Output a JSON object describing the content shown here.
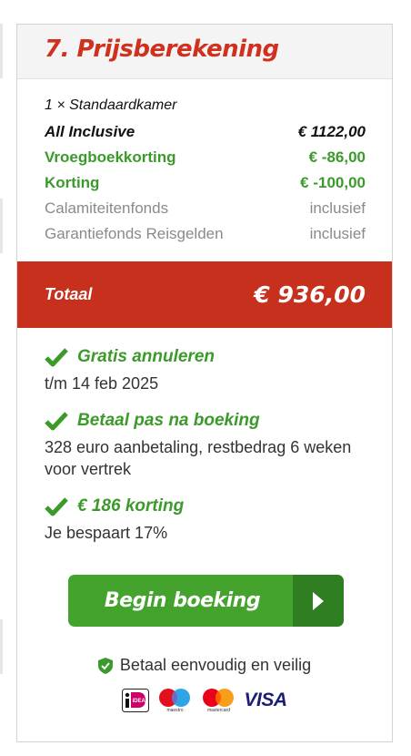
{
  "section": {
    "title": "7. Prijsberekening"
  },
  "lines": [
    {
      "label": "1 × Standaardkamer",
      "value": ""
    },
    {
      "label": "All Inclusive",
      "value": "€ 1122,00"
    },
    {
      "label": "Vroegboekkorting",
      "value": "€ -86,00"
    },
    {
      "label": "Korting",
      "value": "€ -100,00"
    },
    {
      "label": "Calamiteitenfonds",
      "value": "inclusief"
    },
    {
      "label": "Garantiefonds Reisgelden",
      "value": "inclusief"
    }
  ],
  "total": {
    "label": "Totaal",
    "value": "€ 936,00"
  },
  "benefits": [
    {
      "icon": "check-icon",
      "title": "Gratis annuleren",
      "description": "t/m 14 feb 2025"
    },
    {
      "icon": "check-icon",
      "title": "Betaal pas na boeking",
      "description": "328 euro aanbetaling, restbedrag 6 weken voor vertrek"
    },
    {
      "icon": "check-icon",
      "title": "€ 186 korting",
      "description": "Je bespaart 17%"
    }
  ],
  "cta": {
    "label": "Begin boeking",
    "icon": "chevron-right-icon"
  },
  "secure": {
    "icon": "shield-check-icon",
    "text": "Betaal eenvoudig en veilig"
  },
  "payments": {
    "ideal": "iDEAL",
    "maestro": "maestro",
    "mastercard": "mastercard",
    "visa": "VISA"
  },
  "colors": {
    "brand_red": "#c6301d",
    "title_red": "#d0311f",
    "green": "#3c9a2a",
    "cta_green": "#43a32d",
    "cta_dark": "#2f7f22"
  }
}
